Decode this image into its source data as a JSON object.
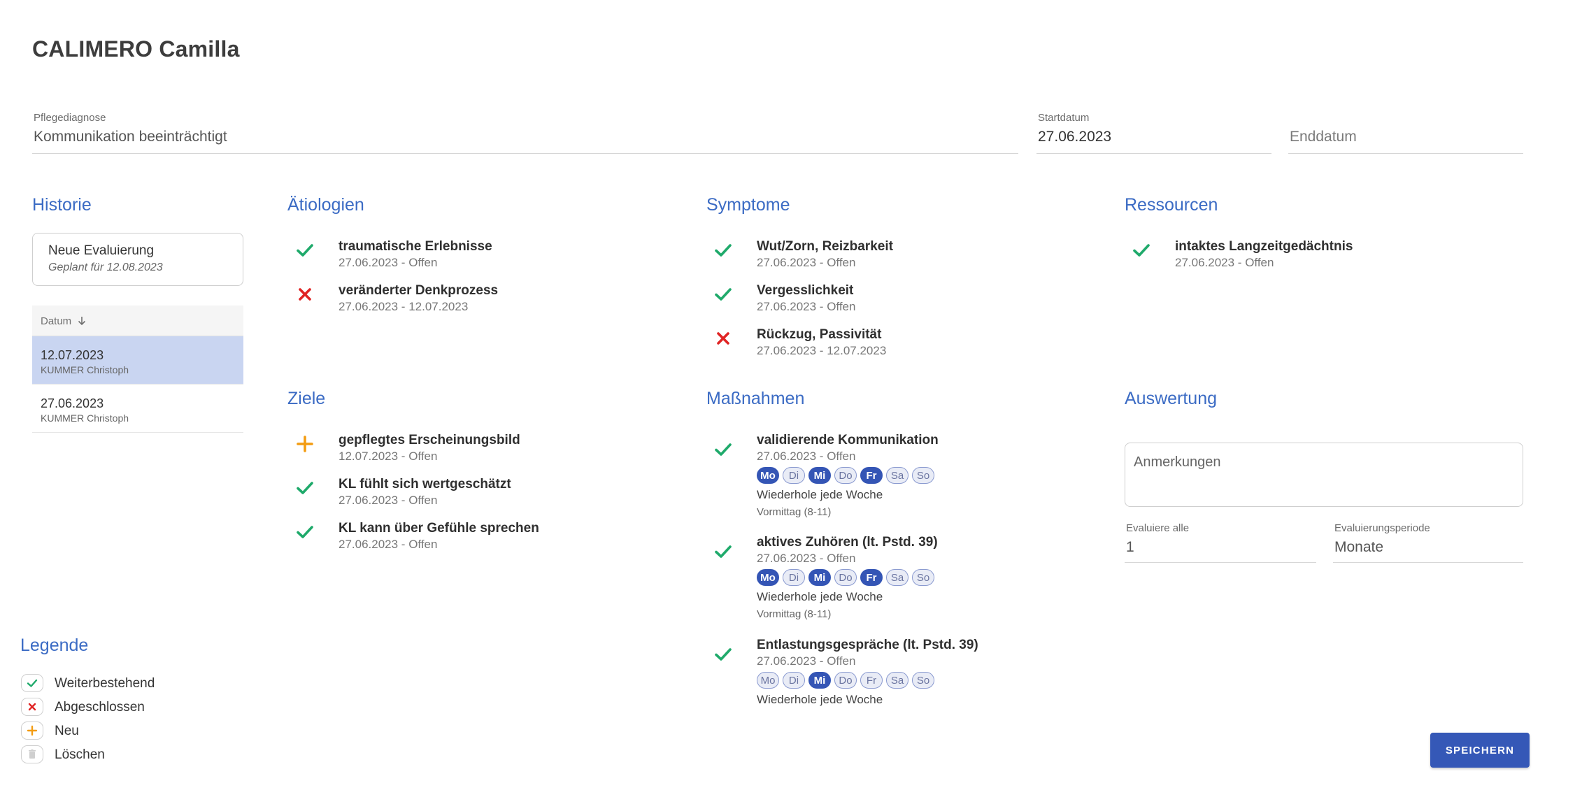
{
  "patient": {
    "name": "CALIMERO Camilla"
  },
  "diagnosis": {
    "label": "Pflegediagnose",
    "value": "Kommunikation beeinträchtigt"
  },
  "start_date": {
    "label": "Startdatum",
    "value": "27.06.2023"
  },
  "end_date": {
    "placeholder": "Enddatum"
  },
  "history": {
    "title": "Historie",
    "new_evaluation": {
      "title": "Neue Evaluierung",
      "subtitle": "Geplant für 12.08.2023"
    },
    "column_header": "Datum",
    "sort_icon": "arrow-down-icon",
    "rows": [
      {
        "date": "12.07.2023",
        "user": "KUMMER Christoph"
      },
      {
        "date": "27.06.2023",
        "user": "KUMMER Christoph"
      }
    ]
  },
  "aetiologien": {
    "title": "Ätiologien",
    "items": [
      {
        "title": "traumatische Erlebnisse",
        "sub": "27.06.2023 - Offen",
        "status": "check"
      },
      {
        "title": "veränderter Denkprozess",
        "sub": "27.06.2023 - 12.07.2023",
        "status": "cross"
      }
    ]
  },
  "symptome": {
    "title": "Symptome",
    "items": [
      {
        "title": "Wut/Zorn, Reizbarkeit",
        "sub": "27.06.2023 - Offen",
        "status": "check"
      },
      {
        "title": "Vergesslichkeit",
        "sub": "27.06.2023 - Offen",
        "status": "check"
      },
      {
        "title": "Rückzug, Passivität",
        "sub": "27.06.2023 - 12.07.2023",
        "status": "cross"
      }
    ]
  },
  "ressourcen": {
    "title": "Ressourcen",
    "items": [
      {
        "title": "intaktes Langzeitgedächtnis",
        "sub": "27.06.2023 - Offen",
        "status": "check"
      }
    ]
  },
  "ziele": {
    "title": "Ziele",
    "items": [
      {
        "title": "gepflegtes Erscheinungsbild",
        "sub": "12.07.2023 - Offen",
        "status": "plus"
      },
      {
        "title": "KL fühlt sich wertgeschätzt",
        "sub": "27.06.2023 - Offen",
        "status": "check"
      },
      {
        "title": "KL kann über Gefühle sprechen",
        "sub": "27.06.2023 - Offen",
        "status": "check"
      }
    ]
  },
  "day_labels": [
    "Mo",
    "Di",
    "Mi",
    "Do",
    "Fr",
    "Sa",
    "So"
  ],
  "massnahmen": {
    "title": "Maßnahmen",
    "items": [
      {
        "title": "validierende Kommunikation",
        "sub": "27.06.2023 - Offen",
        "status": "check",
        "days_active": [
          true,
          false,
          true,
          false,
          true,
          false,
          false
        ],
        "repeat": "Wiederhole jede Woche",
        "slot": "Vormittag (8-11)"
      },
      {
        "title": "aktives Zuhören (lt. Pstd. 39)",
        "sub": "27.06.2023 - Offen",
        "status": "check",
        "days_active": [
          true,
          false,
          true,
          false,
          true,
          false,
          false
        ],
        "repeat": "Wiederhole jede Woche",
        "slot": "Vormittag (8-11)"
      },
      {
        "title": "Entlastungsgespräche (lt. Pstd. 39)",
        "sub": "27.06.2023 - Offen",
        "status": "check",
        "days_active": [
          false,
          false,
          true,
          false,
          false,
          false,
          false
        ],
        "repeat": "Wiederhole jede Woche"
      }
    ]
  },
  "auswertung": {
    "title": "Auswertung",
    "notes_placeholder": "Anmerkungen",
    "evaluate_every": {
      "label": "Evaluiere alle",
      "value": "1"
    },
    "period": {
      "label": "Evaluierungsperiode",
      "value": "Monate"
    }
  },
  "legend": {
    "title": "Legende",
    "items": [
      {
        "label": "Weiterbestehend",
        "icon": "check-icon"
      },
      {
        "label": "Abgeschlossen",
        "icon": "cross-icon"
      },
      {
        "label": "Neu",
        "icon": "plus-icon"
      },
      {
        "label": "Löschen",
        "icon": "trash-icon"
      }
    ]
  },
  "actions": {
    "save_label": "SPEICHERN"
  },
  "colors": {
    "accent": "#3b6bc4",
    "button": "#3558b7",
    "check": "#1faa6b",
    "cross": "#e02424",
    "plus": "#f39c12",
    "selected_row": "#c9d5f1"
  }
}
